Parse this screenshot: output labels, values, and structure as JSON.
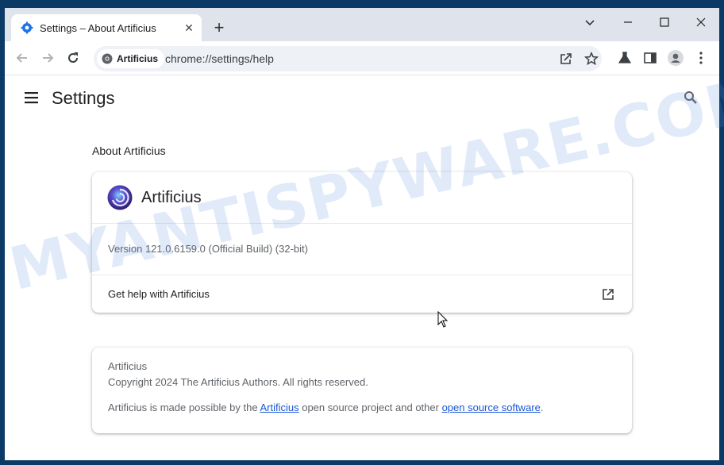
{
  "tab": {
    "title": "Settings – About Artificius"
  },
  "address": {
    "chip_label": "Artificius",
    "url": "chrome://settings/help"
  },
  "page": {
    "title": "Settings",
    "section_title": "About Artificius",
    "product_name": "Artificius",
    "version": "Version 121.0.6159.0 (Official Build) (32-bit)",
    "help_label": "Get help with Artificius"
  },
  "copyright_card": {
    "name": "Artificius",
    "copyright": "Copyright 2024 The Artificius Authors. All rights reserved.",
    "made_possible_prefix": "Artificius is made possible by the ",
    "project_link": "Artificius",
    "made_possible_middle": " open source project and other ",
    "oss_link": "open source software",
    "made_possible_suffix": "."
  },
  "watermark": "MYANTISPYWARE.COM",
  "colors": {
    "titlebar": "#dfe3eb",
    "omnibox": "#eef1f6",
    "link": "#1a56d6",
    "desktop": "#0c3a66"
  },
  "icons": [
    "gear-icon",
    "close-icon",
    "plus-icon",
    "chevron-down-icon",
    "minimize-icon",
    "maximize-icon",
    "back-icon",
    "forward-icon",
    "reload-icon",
    "share-icon",
    "star-icon",
    "lab-icon",
    "sidepanel-icon",
    "profile-icon",
    "menu-dots-icon",
    "hamburger-icon",
    "search-icon",
    "external-link-icon",
    "cursor-icon"
  ]
}
